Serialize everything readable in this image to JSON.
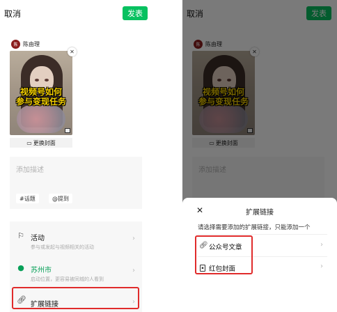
{
  "editor": {
    "cancel_label": "取消",
    "publish_label": "发表",
    "author_avatar_text": "陈",
    "author_name": "陈由理",
    "cover_text_line1": "视频号如何",
    "cover_text_line2": "参与变现任务",
    "change_cover_label": "更换封面",
    "description_placeholder": "添加描述",
    "chips": {
      "topic": "#话题",
      "mention": "@提到"
    },
    "options": [
      {
        "icon": "flag-icon",
        "title": "活动",
        "subtitle": "参与或发起与视频相关的活动"
      },
      {
        "icon": "location-pin-icon",
        "title": "苏州市",
        "subtitle": "启动位置，更容易被同城的人看到"
      },
      {
        "icon": "link-icon",
        "title": "扩展链接",
        "subtitle": ""
      }
    ],
    "accent_color": "#07c160",
    "highlight_color": "#e02b2b"
  },
  "sheet": {
    "title": "扩展链接",
    "hint": "请选择需要添加的扩展链接，只能添加一个",
    "items": [
      {
        "icon": "link-icon",
        "label": "公众号文章"
      },
      {
        "icon": "red-envelope-icon",
        "label": "红包封面"
      }
    ]
  }
}
